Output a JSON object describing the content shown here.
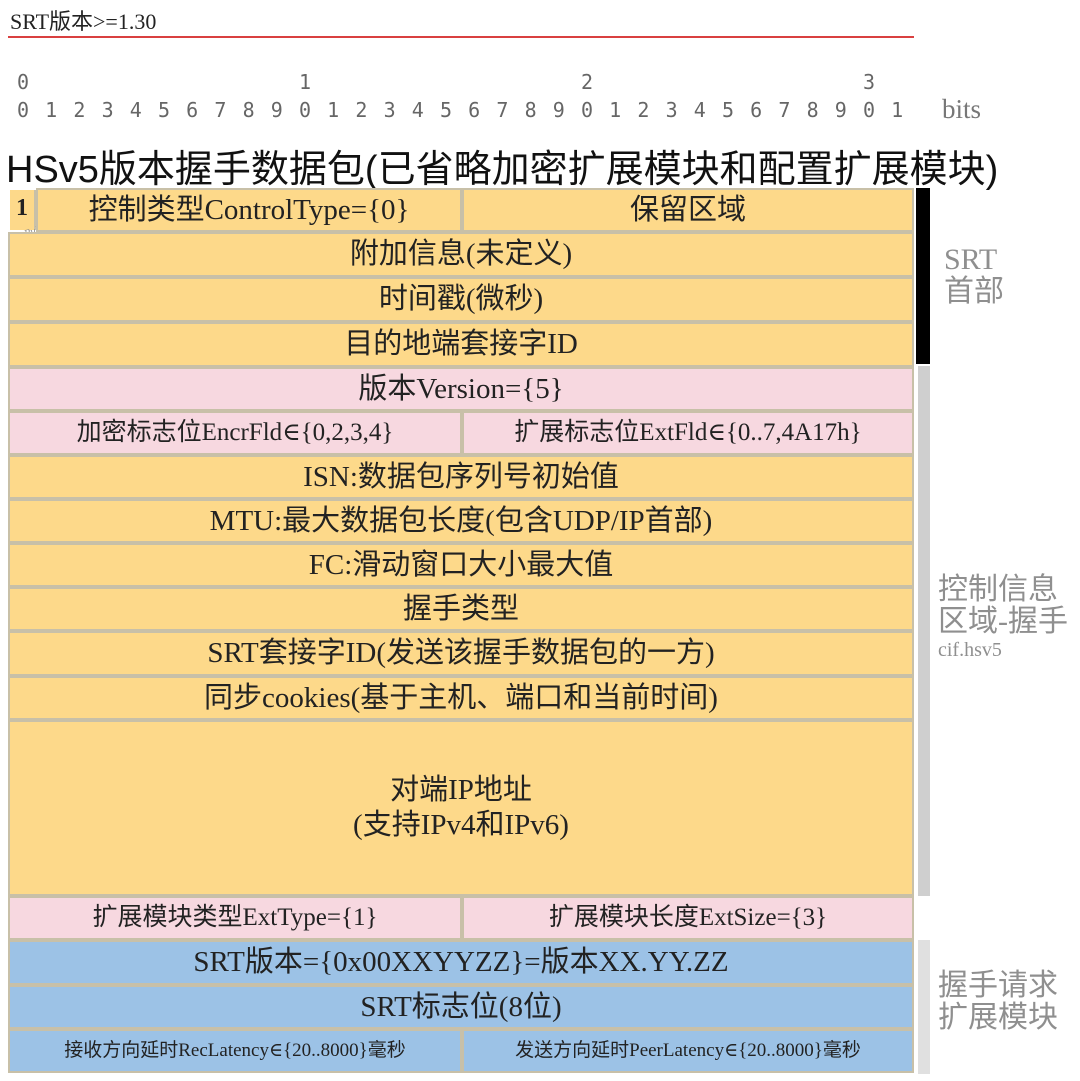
{
  "header": {
    "version_label": "SRT版本>=1.30",
    "bits_tens": [
      "0",
      "1",
      "2",
      "3"
    ],
    "bits_units": [
      "0",
      "1",
      "2",
      "3",
      "4",
      "5",
      "6",
      "7",
      "8",
      "9",
      "0",
      "1",
      "2",
      "3",
      "4",
      "5",
      "6",
      "7",
      "8",
      "9",
      "0",
      "1",
      "2",
      "3",
      "4",
      "5",
      "6",
      "7",
      "8",
      "9",
      "0",
      "1"
    ],
    "bits_word": "bits",
    "title": "HSv5版本握手数据包(已省略加密扩展模块和配置扩展模块)"
  },
  "packet": {
    "flag": "1",
    "control_type": "控制类型ControlType={0}",
    "reserved": "保留区域",
    "additional_info": "附加信息(未定义)",
    "timestamp": "时间戳(微秒)",
    "dest_socket_id": "目的地端套接字ID",
    "version": "版本Version={5}",
    "encr_fld": "加密标志位EncrFld∈{0,2,3,4}",
    "ext_fld": "扩展标志位ExtFld∈{0..7,4A17h}",
    "isn": "ISN:数据包序列号初始值",
    "mtu": "MTU:最大数据包长度(包含UDP/IP首部)",
    "fc": "FC:滑动窗口大小最大值",
    "handshake_type": "握手类型",
    "srt_socket_id": "SRT套接字ID(发送该握手数据包的一方)",
    "syn_cookie": "同步cookies(基于主机、端口和当前时间)",
    "peer_ip_line1": "对端IP地址",
    "peer_ip_line2": "(支持IPv4和IPv6)",
    "ext_type": "扩展模块类型ExtType={1}",
    "ext_size": "扩展模块长度ExtSize={3}",
    "srt_version": "SRT版本={0x00XXYYZZ}=版本XX.YY.ZZ",
    "srt_flags": "SRT标志位(8位)",
    "rec_latency": "接收方向延时RecLatency∈{20..8000}毫秒",
    "peer_latency": "发送方向延时PeerLatency∈{20..8000}毫秒"
  },
  "side": {
    "srt_header_line1": "SRT",
    "srt_header_line2": "首部",
    "cif_line1": "控制信息",
    "cif_line2": "区域-握手",
    "cif_line3": "cif.hsv5",
    "ext_line1": "握手请求",
    "ext_line2": "扩展模块"
  },
  "colors": {
    "header_fill": "#fdd98a",
    "cif_fill": "#f7d8e0",
    "extension_fill": "#9cc2e6",
    "srt_header_bar": "#000000",
    "cif_bar": "#cfcfcf",
    "rule": "#d94040"
  }
}
